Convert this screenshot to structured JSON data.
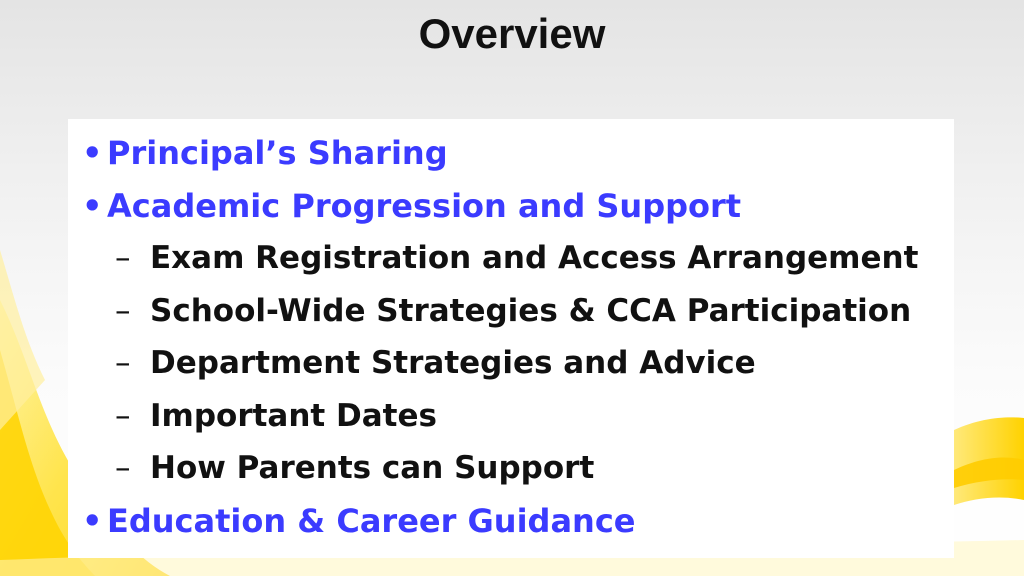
{
  "slide": {
    "title": "Overview",
    "outline": [
      {
        "level": 1,
        "marker": "•",
        "text": "Principal’s Sharing"
      },
      {
        "level": 1,
        "marker": "•",
        "text": "Academic Progression and Support"
      },
      {
        "level": 2,
        "marker": "–",
        "text": "Exam Registration and Access Arrangement"
      },
      {
        "level": 2,
        "marker": "–",
        "text": "School-Wide Strategies & CCA Participation"
      },
      {
        "level": 2,
        "marker": "–",
        "text": "Department Strategies and Advice"
      },
      {
        "level": 2,
        "marker": "–",
        "text": "Important Dates"
      },
      {
        "level": 2,
        "marker": "–",
        "text": "How Parents can Support"
      },
      {
        "level": 1,
        "marker": "•",
        "text": "Education & Career Guidance"
      }
    ]
  },
  "colors": {
    "level_1_text": "#3b3bff",
    "level_2_text": "#111111",
    "accent_swoosh": "#ffd400"
  }
}
